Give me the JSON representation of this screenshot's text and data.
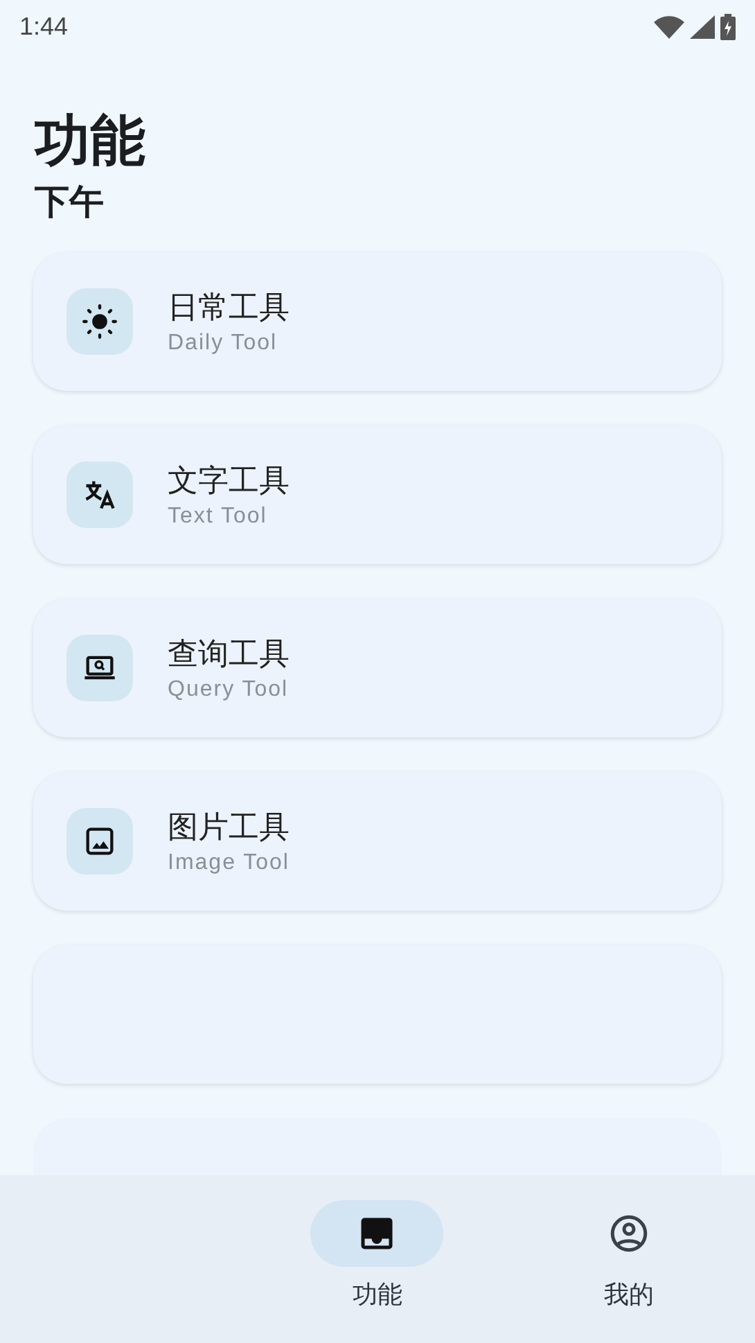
{
  "status_bar": {
    "time": "1:44"
  },
  "header": {
    "title": "功能",
    "subtitle": "下午"
  },
  "tools": [
    {
      "kind": "tool",
      "title": "日常工具",
      "subtitle": "Daily Tool"
    },
    {
      "kind": "tool",
      "title": "文字工具",
      "subtitle": "Text Tool"
    },
    {
      "kind": "tool",
      "title": "查询工具",
      "subtitle": "Query Tool"
    },
    {
      "kind": "tool",
      "title": "图片工具",
      "subtitle": "Image Tool"
    },
    {
      "kind": "empty"
    },
    {
      "kind": "empty"
    }
  ],
  "bottom_nav": [
    {
      "label": "功能",
      "selected": true
    },
    {
      "label": "我的",
      "selected": false
    }
  ]
}
